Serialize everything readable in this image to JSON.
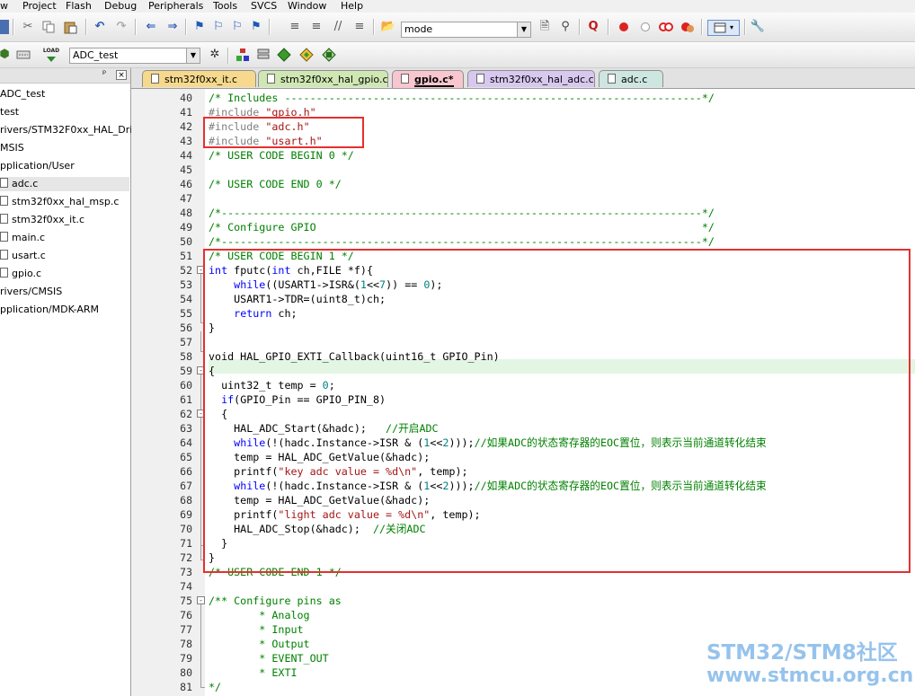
{
  "menu": [
    "w",
    "Project",
    "Flash",
    "Debug",
    "Peripherals",
    "Tools",
    "SVCS",
    "Window",
    "Help"
  ],
  "toolbar": {
    "mode_combo": "mode",
    "target_combo": "ADC_test",
    "load_label": "LOAD"
  },
  "project_tree": [
    {
      "label": "ADC_test",
      "file": false
    },
    {
      "label": "test",
      "file": false
    },
    {
      "label": "rivers/STM32F0xx_HAL_Driv",
      "file": false
    },
    {
      "label": "MSIS",
      "file": false
    },
    {
      "label": "pplication/User",
      "file": false
    },
    {
      "label": "adc.c",
      "file": true,
      "selected": true
    },
    {
      "label": "stm32f0xx_hal_msp.c",
      "file": true
    },
    {
      "label": "stm32f0xx_it.c",
      "file": true
    },
    {
      "label": "main.c",
      "file": true
    },
    {
      "label": "usart.c",
      "file": true
    },
    {
      "label": "gpio.c",
      "file": true
    },
    {
      "label": "rivers/CMSIS",
      "file": false
    },
    {
      "label": "pplication/MDK-ARM",
      "file": false
    }
  ],
  "tabs": [
    {
      "label": "stm32f0xx_it.c",
      "color": "#f6d98c"
    },
    {
      "label": "stm32f0xx_hal_gpio.c",
      "color": "#cfe7b3"
    },
    {
      "label": "gpio.c*",
      "color": "#f7c6cf",
      "active": true
    },
    {
      "label": "stm32f0xx_hal_adc.c",
      "color": "#d8c8ef"
    },
    {
      "label": "adc.c",
      "color": "#cde6df"
    }
  ],
  "line_numbers": [
    "40",
    "41",
    "42",
    "43",
    "44",
    "45",
    "46",
    "47",
    "48",
    "49",
    "50",
    "51",
    "52",
    "53",
    "54",
    "55",
    "56",
    "57",
    "58",
    "59",
    "60",
    "61",
    "62",
    "63",
    "64",
    "65",
    "66",
    "67",
    "68",
    "69",
    "70",
    "71",
    "72",
    "73",
    "74",
    "75",
    "76",
    "77",
    "78",
    "79",
    "80",
    "81"
  ],
  "code": {
    "l40": "/* Includes ------------------------------------------------------------------*/",
    "l41a": "#include ",
    "l41b": "\"gpio.h\"",
    "l42a": "#include ",
    "l42b": "\"adc.h\"",
    "l43a": "#include ",
    "l43b": "\"usart.h\"",
    "l44": "/* USER CODE BEGIN 0 */",
    "l46": "/* USER CODE END 0 */",
    "l48": "/*----------------------------------------------------------------------------*/",
    "l49": "/* Configure GPIO                                                             */",
    "l50": "/*----------------------------------------------------------------------------*/",
    "l51": "/* USER CODE BEGIN 1 */",
    "l52a": "int",
    "l52b": " fputc(",
    "l52c": "int",
    "l52d": " ch,FILE *f){",
    "l53a": "    ",
    "l53b": "while",
    "l53c": "((USART1->ISR&(",
    "l53d": "1",
    "l53e": "<<",
    "l53f": "7",
    "l53g": ")) == ",
    "l53h": "0",
    "l53i": ");",
    "l54": "    USART1->TDR=(uint8_t)ch;",
    "l55a": "    ",
    "l55b": "return",
    "l55c": " ch;",
    "l56": "}",
    "l58": "void HAL_GPIO_EXTI_Callback(uint16_t GPIO_Pin)",
    "l59": "{",
    "l60a": "  uint32_t temp = ",
    "l60b": "0",
    "l60c": ";",
    "l61a": "  ",
    "l61b": "if",
    "l61c": "(GPIO_Pin == GPIO_PIN_8)",
    "l62": "  {",
    "l63a": "    HAL_ADC_Start(&hadc);   ",
    "l63b": "//开启ADC",
    "l64a": "    ",
    "l64b": "while",
    "l64c": "(!(hadc.Instance->ISR & (",
    "l64d": "1",
    "l64e": "<<",
    "l64f": "2",
    "l64g": ")));",
    "l64h": "//如果ADC的状态寄存器的EOC置位，则表示当前通道转化结束",
    "l65": "    temp = HAL_ADC_GetValue(&hadc);",
    "l66a": "    printf(",
    "l66b": "\"key adc value = %d\\n\"",
    "l66c": ", temp);",
    "l67a": "    ",
    "l67b": "while",
    "l67c": "(!(hadc.Instance->ISR & (",
    "l67d": "1",
    "l67e": "<<",
    "l67f": "2",
    "l67g": ")));",
    "l67h": "//如果ADC的状态寄存器的EOC置位，则表示当前通道转化结束",
    "l68": "    temp = HAL_ADC_GetValue(&hadc);",
    "l69a": "    printf(",
    "l69b": "\"light adc value = %d\\n\"",
    "l69c": ", temp);",
    "l70a": "    HAL_ADC_Stop(&hadc);  ",
    "l70b": "//关闭ADC",
    "l71": "  }",
    "l72": "}",
    "l73": "/* USER CODE END 1 */",
    "l75": "/** Configure pins as",
    "l76": "        * Analog",
    "l77": "        * Input",
    "l78": "        * Output",
    "l79": "        * EVENT_OUT",
    "l80": "        * EXTI",
    "l81": "*/"
  },
  "fold_markers": [
    "-",
    "-",
    "-",
    "-",
    "-"
  ],
  "watermark": {
    "line1": "STM32/STM8社区",
    "line2": "www.stmcu.org.cn"
  },
  "colors": {
    "highlight_box": "#e53030",
    "comment": "#008000",
    "keyword": "#0000ff",
    "string": "#a31515",
    "number": "#008080",
    "current_line": "#e3f6e3"
  }
}
